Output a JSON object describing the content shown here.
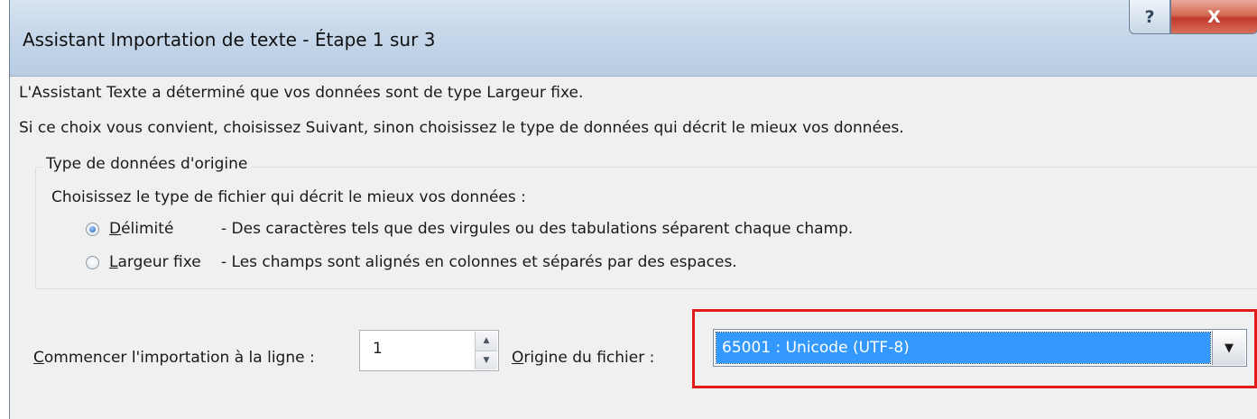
{
  "window": {
    "title": "Assistant Importation de texte - Étape 1 sur 3",
    "help_label": "?",
    "close_label": "X"
  },
  "intro": {
    "line1": "L'Assistant Texte a déterminé que vos données sont de type Largeur fixe.",
    "line2": "Si ce choix vous convient, choisissez Suivant, sinon choisissez le type de données qui décrit le mieux vos données."
  },
  "group": {
    "legend": "Type de données d'origine",
    "prompt": "Choisissez le type de fichier qui décrit le mieux vos données :",
    "options": [
      {
        "accel": "D",
        "rest": "élimité",
        "description": "- Des caractères tels que des virgules ou des tabulations séparent chaque champ.",
        "checked": true
      },
      {
        "accel": "L",
        "rest": "argeur fixe",
        "description": "- Les champs sont alignés en colonnes et séparés par des espaces.",
        "checked": false
      }
    ]
  },
  "start_row": {
    "accel": "C",
    "label_rest": "ommencer l'importation à la ligne :",
    "value": "1"
  },
  "file_origin": {
    "accel": "O",
    "label_rest": "rigine du fichier :",
    "selected": "65001 : Unicode (UTF-8)",
    "highlight_color": "#e31a1a",
    "selection_color": "#3399ff"
  }
}
